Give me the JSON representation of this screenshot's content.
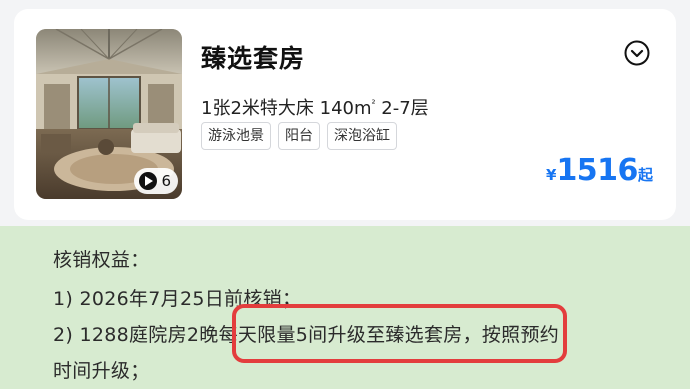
{
  "room": {
    "title": "臻选套房",
    "specs_prefix": "1张2米特大床 140m",
    "specs_sup": "²",
    "specs_suffix": " 2-7层",
    "tags": [
      "游泳池景",
      "阳台",
      "深泡浴缸"
    ],
    "media_count": "6",
    "price": {
      "currency": "¥",
      "amount": "1516",
      "suffix": "起"
    }
  },
  "benefits": {
    "heading": "核销权益：",
    "line1": "1) 2026年7月25日前核销；",
    "line2": "2) 1288庭院房2晚每天限量5间升级至臻选套房，按照预约",
    "line3": "时间升级；"
  },
  "colors": {
    "price_blue": "#1775f2",
    "benefit_bg": "#d7ebd0",
    "highlight_red": "#e33d3d"
  },
  "icons": [
    "play-icon",
    "chevron-down-icon"
  ]
}
